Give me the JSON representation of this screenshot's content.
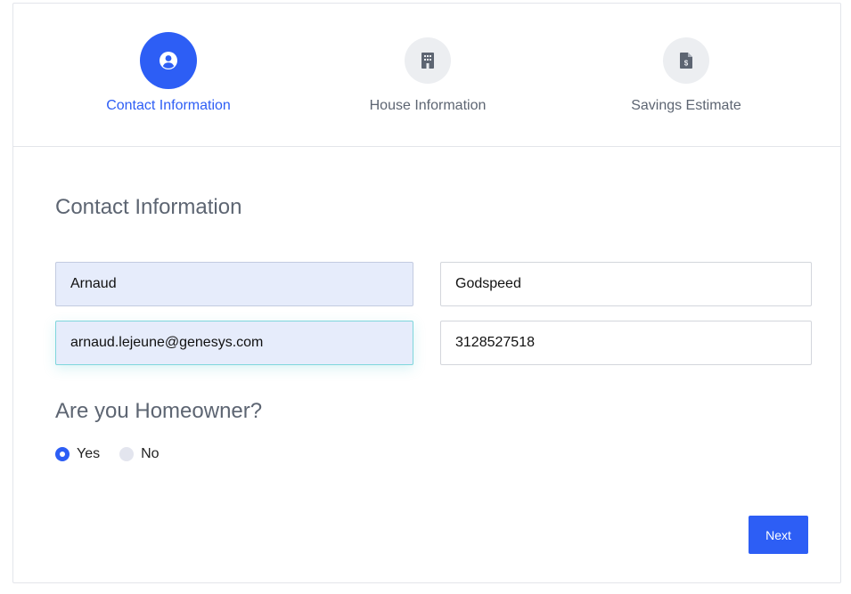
{
  "stepper": {
    "steps": [
      {
        "label": "Contact Information",
        "icon": "user-circle-icon",
        "active": true
      },
      {
        "label": "House Information",
        "icon": "building-icon",
        "active": false
      },
      {
        "label": "Savings Estimate",
        "icon": "invoice-dollar-icon",
        "active": false
      }
    ]
  },
  "form": {
    "title": "Contact Information",
    "first_name": "Arnaud",
    "last_name": "Godspeed",
    "email": "arnaud.lejeune@genesys.com",
    "phone": "3128527518"
  },
  "homeowner": {
    "question": "Are you Homeowner?",
    "options": [
      "Yes",
      "No"
    ],
    "selected": "Yes"
  },
  "actions": {
    "next_label": "Next"
  },
  "colors": {
    "accent": "#2d5ef5",
    "muted_text": "#5d6572",
    "filled_field": "#e6ecfb"
  }
}
